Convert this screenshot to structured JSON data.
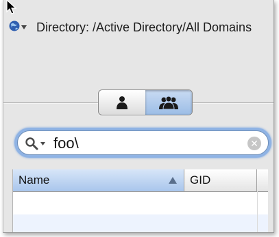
{
  "directory": {
    "label": "Directory: /Active Directory/All Domains",
    "icon": "globe-icon"
  },
  "view_toggle": {
    "options": [
      {
        "icon": "user-icon",
        "selected": false
      },
      {
        "icon": "group-icon",
        "selected": true
      }
    ]
  },
  "search": {
    "value": "foo\\",
    "icon": "magnifier-icon"
  },
  "table": {
    "columns": [
      {
        "label": "Name",
        "sorted": "ascending"
      },
      {
        "label": "GID"
      }
    ]
  },
  "colors": {
    "selected_header": "#a9c6ec",
    "search_focus_ring": "#8fb3e4",
    "panel_background": "#e6e6e6",
    "alt_row": "#edf3fe"
  }
}
